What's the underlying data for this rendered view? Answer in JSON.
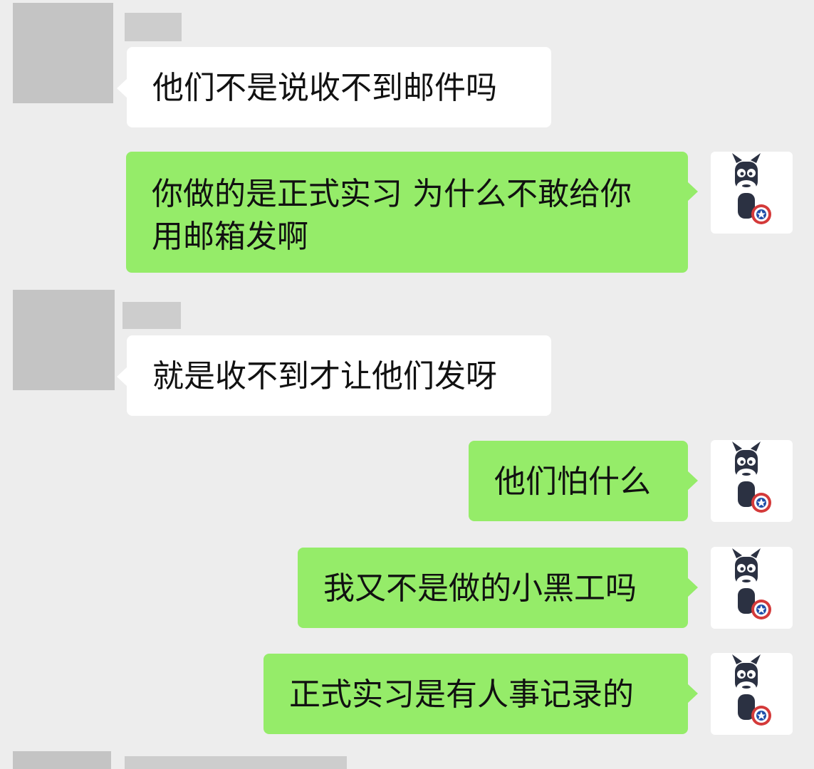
{
  "conversation": {
    "messages": [
      {
        "side": "in",
        "text": "他们不是说收不到邮件吗"
      },
      {
        "side": "out",
        "text": "你做的是正式实习 为什么不敢给你\n用邮箱发啊"
      },
      {
        "side": "in",
        "text": "就是收不到才让他们发呀"
      },
      {
        "side": "out",
        "text": "他们怕什么"
      },
      {
        "side": "out",
        "text": "我又不是做的小黑工吗"
      },
      {
        "side": "out",
        "text": "正式实习是有人事记录的"
      }
    ]
  },
  "colors": {
    "background": "#ededed",
    "incoming_bubble": "#ffffff",
    "outgoing_bubble": "#95ec69",
    "redacted": "#c4c4c4"
  },
  "icons": {
    "self_avatar": "donkey-captain-shield-avatar-icon"
  }
}
